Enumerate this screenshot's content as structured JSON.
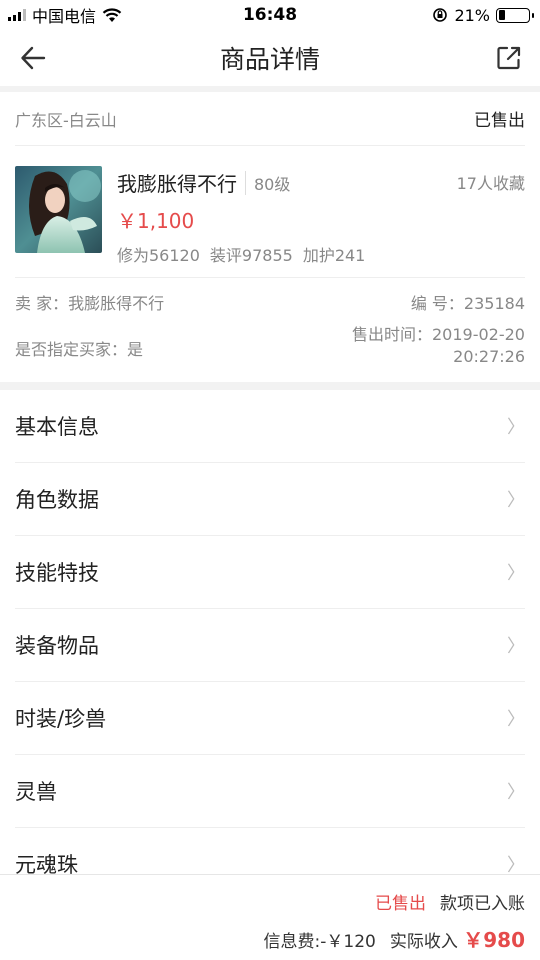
{
  "status_bar": {
    "carrier": "中国电信",
    "time": "16:48",
    "battery_percent": "21%",
    "battery_level": 0.21
  },
  "nav": {
    "title": "商品详情",
    "back_icon": "back-arrow-icon",
    "share_icon": "share-icon"
  },
  "location": {
    "region": "广东区-白云山",
    "status": "已售出"
  },
  "item": {
    "name": "我膨胀得不行",
    "level": "80级",
    "favorites": "17人收藏",
    "price": "￥1,100",
    "stats": [
      "修为56120",
      "装评97855",
      "加护241"
    ]
  },
  "meta": {
    "seller": "卖 家：我膨胀得不行",
    "serial": "编 号：235184",
    "designated_buyer": "是否指定买家：是",
    "sale_time_label": "售出时间：2019-02-20",
    "sale_time_clock": "20:27:26"
  },
  "menu": [
    {
      "label": "基本信息"
    },
    {
      "label": "角色数据"
    },
    {
      "label": "技能特技"
    },
    {
      "label": "装备物品"
    },
    {
      "label": "时装/珍兽"
    },
    {
      "label": "灵兽"
    },
    {
      "label": "元魂珠"
    }
  ],
  "footer": {
    "sold": "已售出",
    "paid": "款项已入账",
    "fee": "信息费:-￥120",
    "income_label": "实际收入",
    "income_value": "￥980"
  },
  "colors": {
    "accent_red": "#e54b4b",
    "muted": "#888888",
    "divider": "#eeeeee"
  }
}
